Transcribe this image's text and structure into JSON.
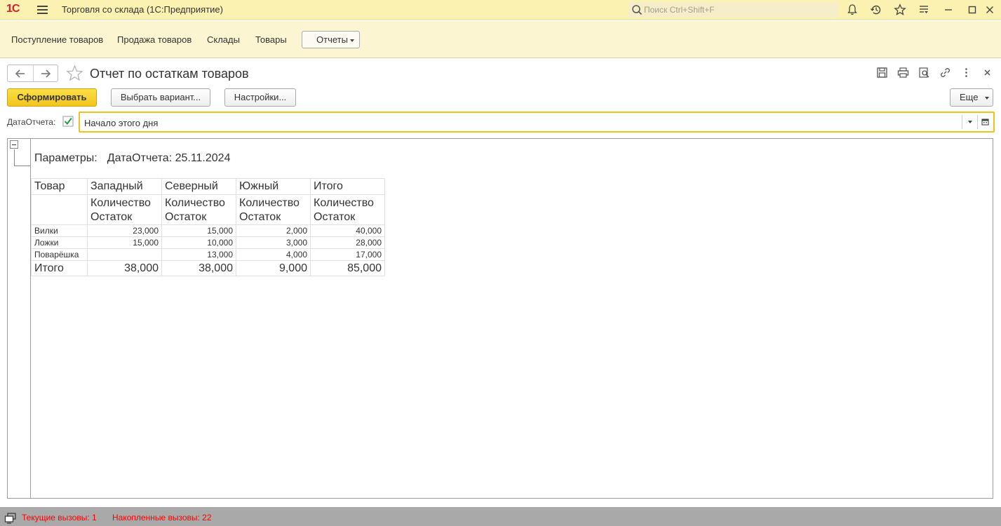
{
  "titlebar": {
    "logo": "1С",
    "title": "Торговля со склада  (1С:Предприятие)",
    "search_placeholder": "Поиск Ctrl+Shift+F"
  },
  "menubar": {
    "items": [
      "Поступление товаров",
      "Продажа товаров",
      "Склады",
      "Товары"
    ],
    "reports_label": "Отчеты"
  },
  "form": {
    "title": "Отчет по остаткам товаров",
    "generate_label": "Сформировать",
    "choose_variant_label": "Выбрать вариант...",
    "settings_label": "Настройки...",
    "more_label": "Еще"
  },
  "date_param": {
    "label": "ДатаОтчета:",
    "checked": true,
    "value": "Начало этого дня"
  },
  "report": {
    "params_label": "Параметры:",
    "params_value": "ДатаОтчета: 25.11.2024",
    "header": {
      "product": "Товар",
      "warehouses": [
        "Западный",
        "Северный",
        "Южный",
        "Итого"
      ],
      "measure_line1": "Количество",
      "measure_line2": "Остаток"
    },
    "rows": [
      {
        "name": "Вилки",
        "values": [
          "23,000",
          "15,000",
          "2,000",
          "40,000"
        ]
      },
      {
        "name": "Ложки",
        "values": [
          "15,000",
          "10,000",
          "3,000",
          "28,000"
        ]
      },
      {
        "name": "Поварёшка",
        "values": [
          "",
          "13,000",
          "4,000",
          "17,000"
        ]
      }
    ],
    "total": {
      "name": "Итого",
      "values": [
        "38,000",
        "38,000",
        "9,000",
        "85,000"
      ]
    }
  },
  "statusbar": {
    "current_calls": "Текущие вызовы: 1",
    "accumulated_calls": "Накопленные вызовы: 22"
  },
  "colors": {
    "titlebar_bg": "#fbf1b0",
    "menubar_bg": "#fbf5d1",
    "primary_button": "#f2c51a",
    "date_field_border": "#f0c21f",
    "status_text": "#ff0000",
    "logo": "#d2232a"
  }
}
